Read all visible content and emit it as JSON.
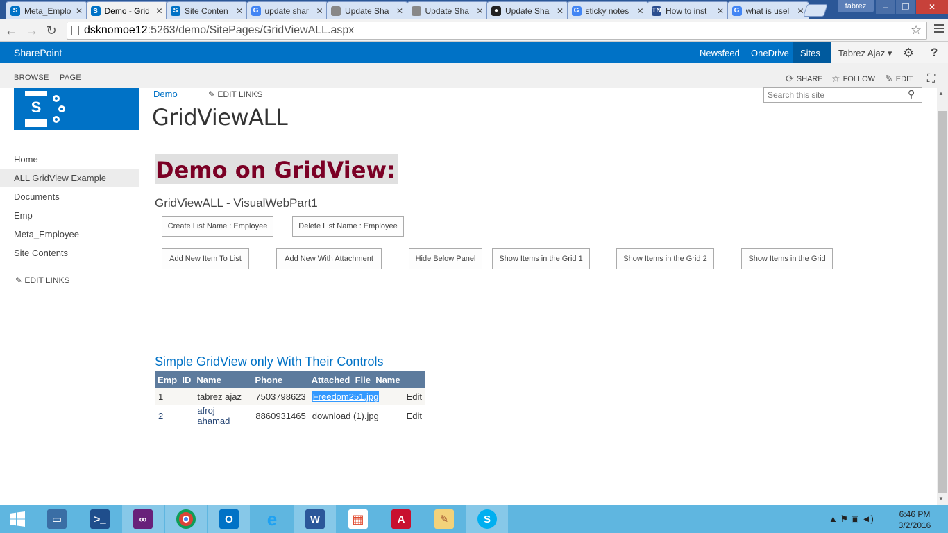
{
  "browser": {
    "tabs": [
      {
        "label": "Meta_Emplo",
        "icon": "sharepoint-icon",
        "color": "#0072c6",
        "glyph": "S"
      },
      {
        "label": "Demo - Grid",
        "icon": "sharepoint-icon",
        "color": "#0072c6",
        "glyph": "S"
      },
      {
        "label": "Site Conten",
        "icon": "sharepoint-icon",
        "color": "#0072c6",
        "glyph": "S"
      },
      {
        "label": "update shar",
        "icon": "google-icon",
        "color": "#4285f4",
        "glyph": "G"
      },
      {
        "label": "Update Sha",
        "icon": "document-icon",
        "color": "#888888",
        "glyph": ""
      },
      {
        "label": "Update Sha",
        "icon": "document-icon",
        "color": "#888888",
        "glyph": ""
      },
      {
        "label": "Update Sha",
        "icon": "github-icon",
        "color": "#222222",
        "glyph": "●"
      },
      {
        "label": "sticky notes",
        "icon": "google-icon",
        "color": "#4285f4",
        "glyph": "G"
      },
      {
        "label": "How to inst",
        "icon": "tn-icon",
        "color": "#2a4d8f",
        "glyph": "TN"
      },
      {
        "label": "what is usel",
        "icon": "google-icon",
        "color": "#4285f4",
        "glyph": "G"
      }
    ],
    "close_glyph": "✕",
    "user": "tabrez",
    "url_host": "dsknomoe12",
    "url_rest": ":5263/demo/SitePages/GridViewALL.aspx"
  },
  "suitebar": {
    "brand": "SharePoint",
    "links": [
      "Newsfeed",
      "OneDrive",
      "Sites"
    ],
    "user": "Tabrez Ajaz",
    "user_caret": "▾"
  },
  "ribbon": {
    "tabs": [
      "BROWSE",
      "PAGE"
    ],
    "actions": [
      {
        "label": "SHARE",
        "icon": "share-icon",
        "glyph": "⟳"
      },
      {
        "label": "FOLLOW",
        "icon": "star-icon",
        "glyph": "☆"
      },
      {
        "label": "EDIT",
        "icon": "pencil-icon",
        "glyph": "✎"
      }
    ]
  },
  "page": {
    "breadcrumb": "Demo",
    "edit_links": "EDIT LINKS",
    "title": "GridViewALL",
    "search_placeholder": "Search this site",
    "nav": [
      "Home",
      "ALL GridView Example",
      "Documents",
      "Emp",
      "Meta_Employee",
      "Site Contents"
    ],
    "nav_selected": 1,
    "nav_edit_links": "EDIT LINKS",
    "heading": "Demo on GridView:",
    "webpart_title": "GridViewALL - VisualWebPart1",
    "buttons_row1": [
      "Create List Name : Employee",
      "Delete List Name : Employee"
    ],
    "buttons_row2": [
      "Add New Item To List",
      "Add New With Attachment",
      "Hide Below Panel",
      "Show Items in the Grid 1",
      "Show Items in the Grid 2",
      "Show Items in the Grid"
    ],
    "grid_title": "Simple GridView only With Their Controls",
    "grid": {
      "headers": [
        "Emp_ID",
        "Name",
        "Phone",
        "Attached_File_Name",
        ""
      ],
      "rows": [
        {
          "id": "1",
          "name": "tabrez ajaz",
          "phone": "7503798623",
          "file": "Freedom251.jpg",
          "action": "Edit"
        },
        {
          "id": "2",
          "name": "afroj ahamad",
          "phone": "8860931465",
          "file": "download (1).jpg",
          "action": "Edit"
        }
      ],
      "header_color": "#5d7b9d"
    }
  },
  "taskbar": {
    "time": "6:46 PM",
    "date": "3/2/2016",
    "tray_glyphs": "▲ ⚑ ▣ ◄)"
  }
}
